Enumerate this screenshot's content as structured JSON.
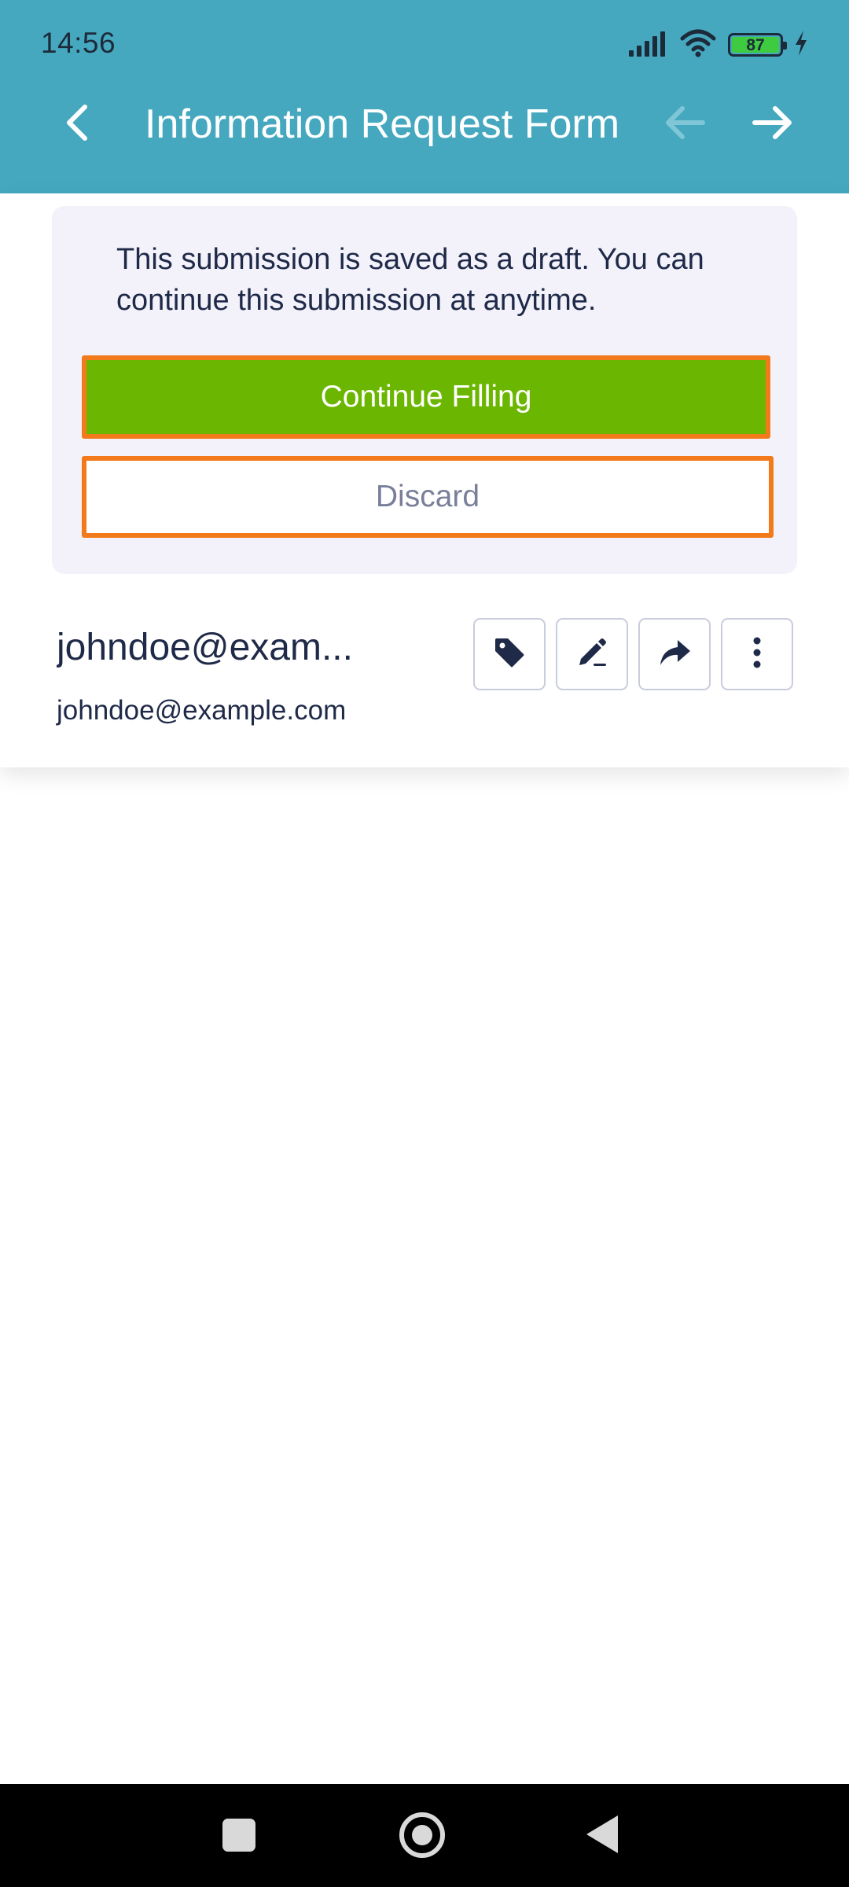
{
  "status_bar": {
    "time": "14:56",
    "battery_level": "87",
    "icons": [
      "signal-icon",
      "wifi-icon",
      "battery-icon",
      "charging-icon"
    ]
  },
  "header": {
    "title": "Information Request Form",
    "back_icon": "chevron-left-icon",
    "prev_icon": "arrow-left-icon",
    "next_icon": "arrow-right-icon",
    "prev_enabled": false,
    "next_enabled": true
  },
  "draft_notice": {
    "message": "This submission is saved as a draft. You can continue this submission at anytime.",
    "continue_label": "Continue Filling",
    "discard_label": "Discard"
  },
  "submission": {
    "title": "johndoe@exam...",
    "subtitle": "johndoe@example.com",
    "actions": [
      "tag-icon",
      "edit-icon",
      "share-icon",
      "more-icon"
    ]
  },
  "colors": {
    "header_bg": "#45a8bf",
    "continue_bg": "#6bb600",
    "highlight_border": "#f27a1a",
    "panel_bg": "#f3f2fb",
    "text_dark": "#1f2a48"
  },
  "system_nav": {
    "icons": [
      "recent-apps-icon",
      "home-icon",
      "back-icon"
    ]
  }
}
